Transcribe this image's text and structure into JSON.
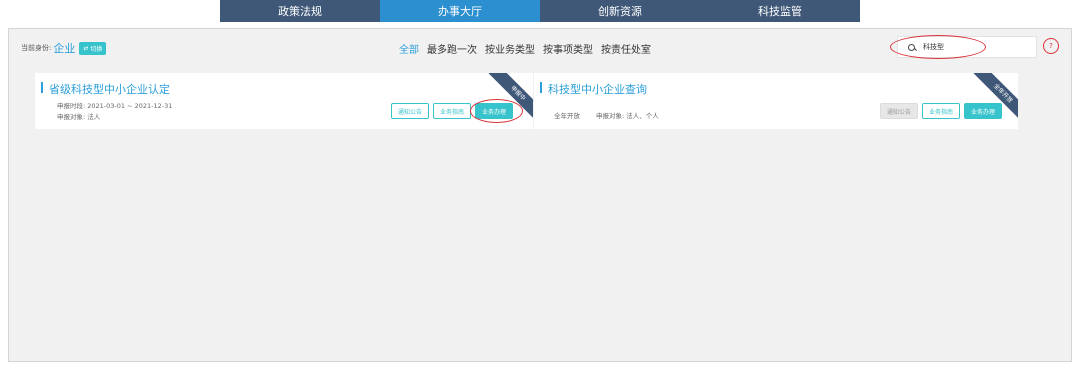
{
  "nav": {
    "tabs": [
      {
        "label": "政策法规"
      },
      {
        "label": "办事大厅"
      },
      {
        "label": "创新资源"
      },
      {
        "label": "科技监管"
      }
    ]
  },
  "identity": {
    "label": "当前身份:",
    "role": "企业",
    "switch_label": "切换"
  },
  "filters": [
    {
      "label": "全部"
    },
    {
      "label": "最多跑一次"
    },
    {
      "label": "按业务类型"
    },
    {
      "label": "按事项类型"
    },
    {
      "label": "按责任处室"
    }
  ],
  "search": {
    "value": "科技型"
  },
  "cards": [
    {
      "title": "省级科技型中小企业认定",
      "period": "申报时段: 2021-03-01 ~ 2021-12-31",
      "target": "申报对象: 法人",
      "ribbon": "申报中",
      "buttons": [
        "通知公告",
        "业务指南",
        "业务办理"
      ]
    },
    {
      "title": "科技型中小企业查询",
      "open": "全年开放",
      "target": "申报对象: 法人、个人",
      "ribbon": "全年开放",
      "buttons": [
        "通知公告",
        "业务指南",
        "业务办理"
      ]
    }
  ],
  "colors": {
    "accent": "#2b9fd9",
    "teal": "#36c3cc",
    "nav": "#3f5878",
    "highlight": "#d9353b"
  }
}
